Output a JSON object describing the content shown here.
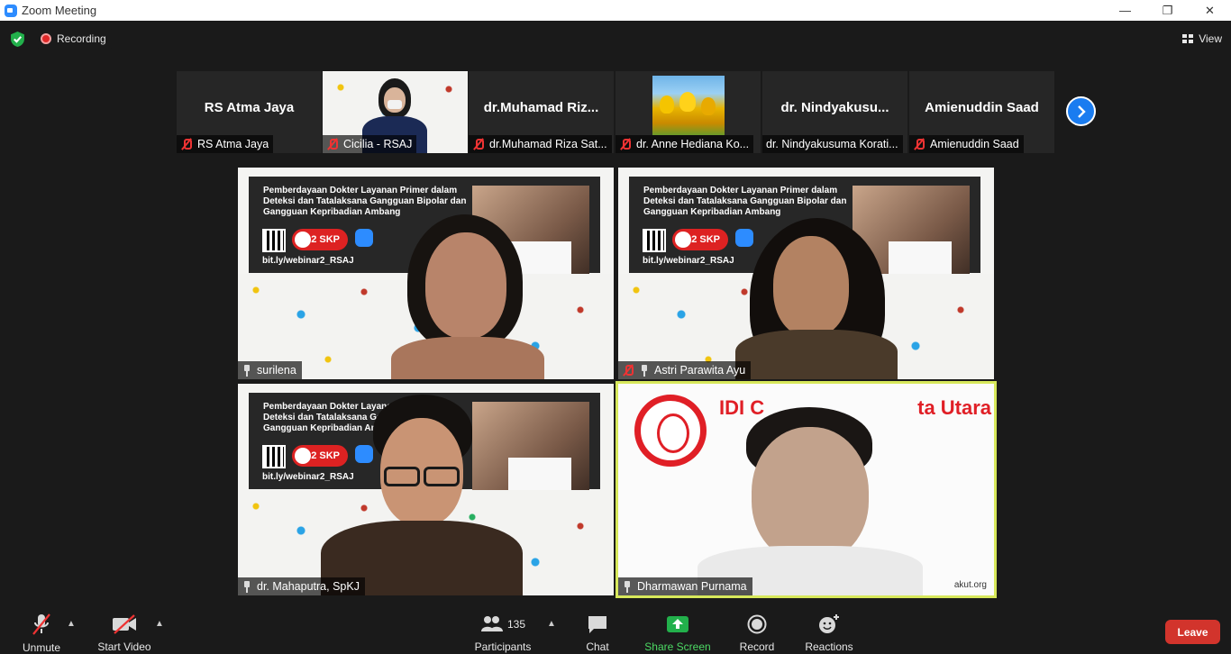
{
  "window": {
    "title": "Zoom Meeting"
  },
  "status": {
    "recording_label": "Recording",
    "view_label": "View"
  },
  "filmstrip": [
    {
      "display_name": "RS Atma Jaya",
      "label": "RS Atma Jaya",
      "muted": true,
      "video": false
    },
    {
      "display_name": "",
      "label": "Cicilia - RSAJ",
      "muted": true,
      "video": true
    },
    {
      "display_name": "dr.Muhamad  Riz...",
      "label": "dr.Muhamad Riza Sat...",
      "muted": true,
      "video": false
    },
    {
      "display_name": "",
      "label": "dr. Anne Hediana Ko...",
      "muted": true,
      "video": true
    },
    {
      "display_name": "dr.  Nindyakusu...",
      "label": "dr. Nindyakusuma Korati...",
      "muted": false,
      "video": false
    },
    {
      "display_name": "Amienuddin Saad",
      "label": "Amienuddin Saad",
      "muted": true,
      "video": false
    }
  ],
  "videos": [
    {
      "label": "surilena",
      "muted": false
    },
    {
      "label": "Astri Parawita Ayu",
      "muted": true
    },
    {
      "label": "dr. Mahaputra, SpKJ",
      "muted": false
    },
    {
      "label": "Dharmawan Purnama",
      "muted": false
    }
  ],
  "backdrop": {
    "banner_line1": "Pemberdayaan Dokter Layanan Primer dalam",
    "banner_line2": "Deteksi dan Tatalaksana Gangguan Bipolar dan",
    "banner_line3": "Gangguan Kepribadian Ambang",
    "skp": "2 SKP",
    "zoom": "zoom",
    "link": "bit.ly/webinar2_RSAJ",
    "idi_title": "IDI C",
    "idi_title2": "ta Utara",
    "idi_footer": "akut.org"
  },
  "toolbar": {
    "unmute": "Unmute",
    "start_video": "Start Video",
    "participants": "Participants",
    "participant_count": "135",
    "chat": "Chat",
    "share_screen": "Share Screen",
    "record": "Record",
    "reactions": "Reactions",
    "leave": "Leave"
  },
  "colors": {
    "accent": "#2d8cff",
    "share_green": "#22b04b",
    "leave_red": "#d2342c",
    "active_speaker": "#d7e85b"
  }
}
